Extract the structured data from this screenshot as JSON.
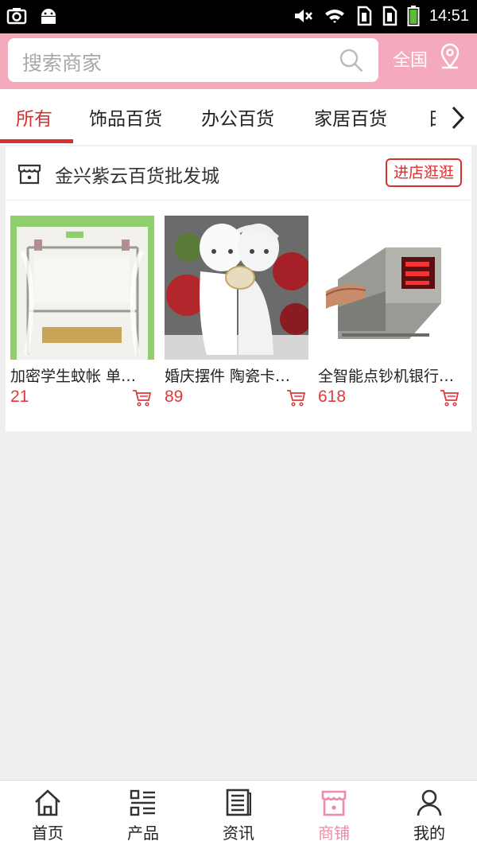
{
  "status_bar": {
    "time": "14:51"
  },
  "search": {
    "placeholder": "搜索商家",
    "region": "全国"
  },
  "tabs": [
    {
      "label": "所有",
      "active": true
    },
    {
      "label": "饰品百货"
    },
    {
      "label": "办公百货"
    },
    {
      "label": "家居百货"
    },
    {
      "label": "日"
    }
  ],
  "store": {
    "name": "金兴紫云百货批发城",
    "visit_label": "进店逛逛",
    "products": [
      {
        "title": "加密学生蚊帐 单人床",
        "price": "21"
      },
      {
        "title": "婚庆摆件 陶瓷卡通娃娃",
        "price": "89"
      },
      {
        "title": "全智能点钞机银行专用",
        "price": "618"
      }
    ]
  },
  "bottom_nav": [
    {
      "label": "首页",
      "icon": "home-icon"
    },
    {
      "label": "产品",
      "icon": "list-icon"
    },
    {
      "label": "资讯",
      "icon": "news-icon"
    },
    {
      "label": "商铺",
      "icon": "store-icon",
      "active": true
    },
    {
      "label": "我的",
      "icon": "user-icon"
    }
  ],
  "colors": {
    "accent": "#d9302f",
    "header": "#f4a9bd",
    "nav_active": "#f08aa6",
    "price": "#e0393b"
  }
}
